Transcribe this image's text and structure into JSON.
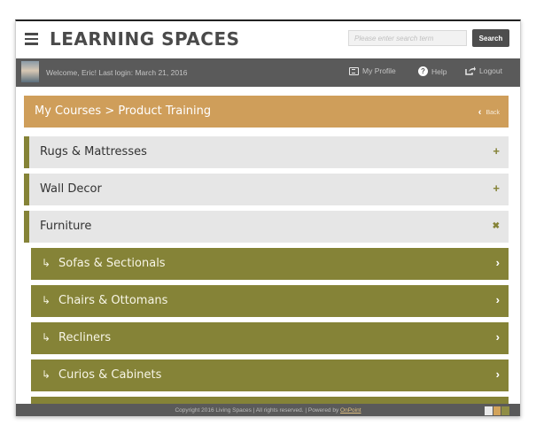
{
  "app": {
    "title": "LEARNING SPACES",
    "search_placeholder": "Please enter search term",
    "search_button": "Search"
  },
  "userbar": {
    "welcome": "Welcome, Eric! Last login: March 21, 2016",
    "links": [
      {
        "label": "My Profile",
        "icon": "profile-icon"
      },
      {
        "label": "Help",
        "icon": "help-icon"
      },
      {
        "label": "Logout",
        "icon": "logout-icon"
      }
    ]
  },
  "breadcrumb": {
    "text": "My Courses  >  Product Training",
    "back_label": "Back"
  },
  "categories": [
    {
      "label": "Rugs & Mattresses",
      "state": "collapsed",
      "symbol": "+"
    },
    {
      "label": "Wall Decor",
      "state": "collapsed",
      "symbol": "+"
    },
    {
      "label": "Furniture",
      "state": "expanded",
      "symbol": "✖"
    }
  ],
  "subcategories": [
    {
      "label": "Sofas & Sectionals"
    },
    {
      "label": "Chairs & Ottomans"
    },
    {
      "label": "Recliners"
    },
    {
      "label": "Curios & Cabinets"
    }
  ],
  "footer": {
    "copyright": "Copyright 2016 Living Spaces | All rights reserved.  |  Powered by ",
    "powered_by": "OnPoint"
  },
  "colors": {
    "accent_olive": "#858337",
    "breadcrumb_tan": "#cf9e5a",
    "bar_gray": "#5a5a5a"
  }
}
